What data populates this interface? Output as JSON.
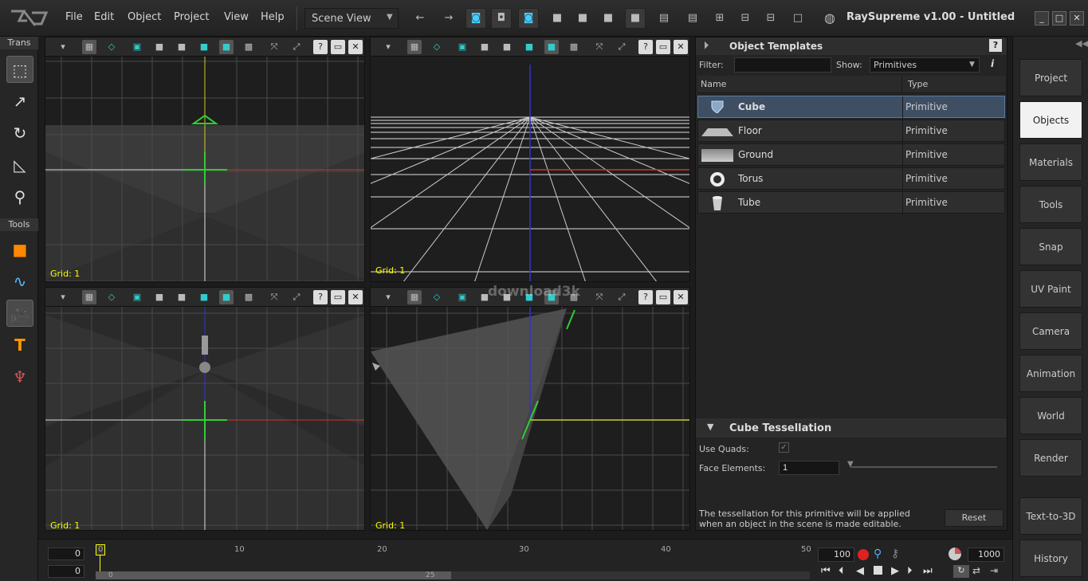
{
  "app": {
    "title": "RaySupreme v1.00 - Untitled"
  },
  "menu": [
    "File",
    "Edit",
    "Object",
    "Project",
    "View",
    "Help"
  ],
  "view_select": {
    "label": "Scene View"
  },
  "left_sections": {
    "trans": "Trans",
    "tools": "Tools"
  },
  "viewports": [
    {
      "grid_label": "Grid: 1"
    },
    {
      "grid_label": "Grid: 1"
    },
    {
      "grid_label": "Grid: 1"
    },
    {
      "grid_label": "Grid: 1"
    }
  ],
  "templates": {
    "title": "Object Templates",
    "filter_label": "Filter:",
    "filter_value": "",
    "show_label": "Show:",
    "show_value": "Primitives",
    "col_name": "Name",
    "col_type": "Type",
    "items": [
      {
        "name": "Cube",
        "type": "Primitive"
      },
      {
        "name": "Floor",
        "type": "Primitive"
      },
      {
        "name": "Ground",
        "type": "Primitive"
      },
      {
        "name": "Torus",
        "type": "Primitive"
      },
      {
        "name": "Tube",
        "type": "Primitive"
      }
    ]
  },
  "tessellation": {
    "title": "Cube Tessellation",
    "use_quads_label": "Use Quads:",
    "use_quads": true,
    "face_elements_label": "Face Elements:",
    "face_elements_value": "1",
    "note": "The tessellation for this primitive will be applied when an object in the scene is made editable.",
    "reset_label": "Reset"
  },
  "right_nav": [
    "Project",
    "Objects",
    "Materials",
    "Tools",
    "Snap",
    "UV Paint",
    "Camera",
    "Animation",
    "World",
    "Render",
    "Text-to-3D",
    "History"
  ],
  "right_nav_active": "Objects",
  "timeline": {
    "frame_top": "0",
    "frame_bottom": "0",
    "ticks": [
      "0",
      "10",
      "20",
      "30",
      "40",
      "50"
    ],
    "scroll_start": "0",
    "scroll_mid": "25",
    "end_frame": "100",
    "total_frames": "1000"
  },
  "watermark": "download3k"
}
